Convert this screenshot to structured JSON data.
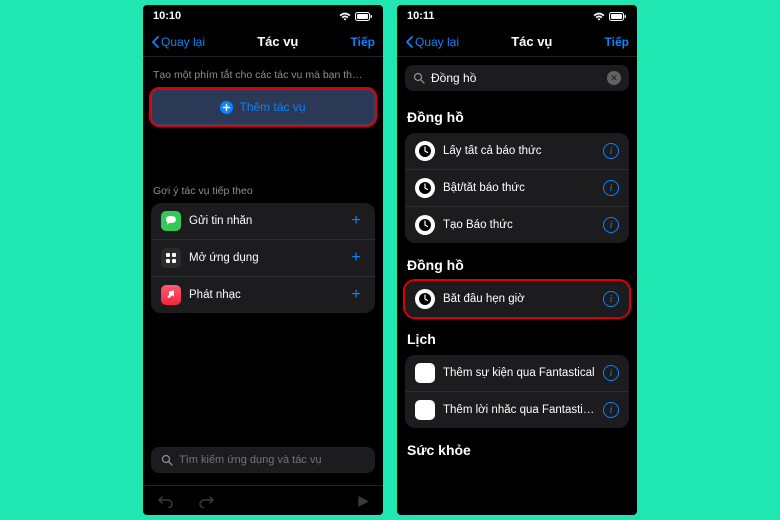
{
  "left": {
    "status": {
      "time": "10:10"
    },
    "nav": {
      "back": "Quay lại",
      "title": "Tác vụ",
      "next": "Tiếp"
    },
    "hint": "Tạo một phím tắt cho các tác vụ mà bạn th…",
    "add_button": "Thêm tác vụ",
    "suggest_label": "Gợi ý tác vụ tiếp theo",
    "suggestions": [
      {
        "label": "Gửi tin nhắn"
      },
      {
        "label": "Mở ứng dụng"
      },
      {
        "label": "Phát nhạc"
      }
    ],
    "search_placeholder": "Tìm kiếm ứng dụng và tác vụ"
  },
  "right": {
    "status": {
      "time": "10:11"
    },
    "nav": {
      "back": "Quay lại",
      "title": "Tác vụ",
      "next": "Tiếp"
    },
    "search_value": "Đồng hồ",
    "sections": {
      "clock1": {
        "title": "Đồng hồ",
        "items": [
          {
            "label": "Lấy tất cả báo thức"
          },
          {
            "label": "Bật/tắt báo thức"
          },
          {
            "label": "Tạo Báo thức"
          }
        ]
      },
      "clock2": {
        "title": "Đồng hồ",
        "items": [
          {
            "label": "Bắt đầu hẹn giờ"
          }
        ]
      },
      "calendar": {
        "title": "Lịch",
        "items": [
          {
            "label": "Thêm sự kiện qua Fantastical"
          },
          {
            "label": "Thêm lời nhắc qua Fantastical"
          }
        ]
      },
      "health": {
        "title": "Sức khỏe"
      }
    }
  }
}
